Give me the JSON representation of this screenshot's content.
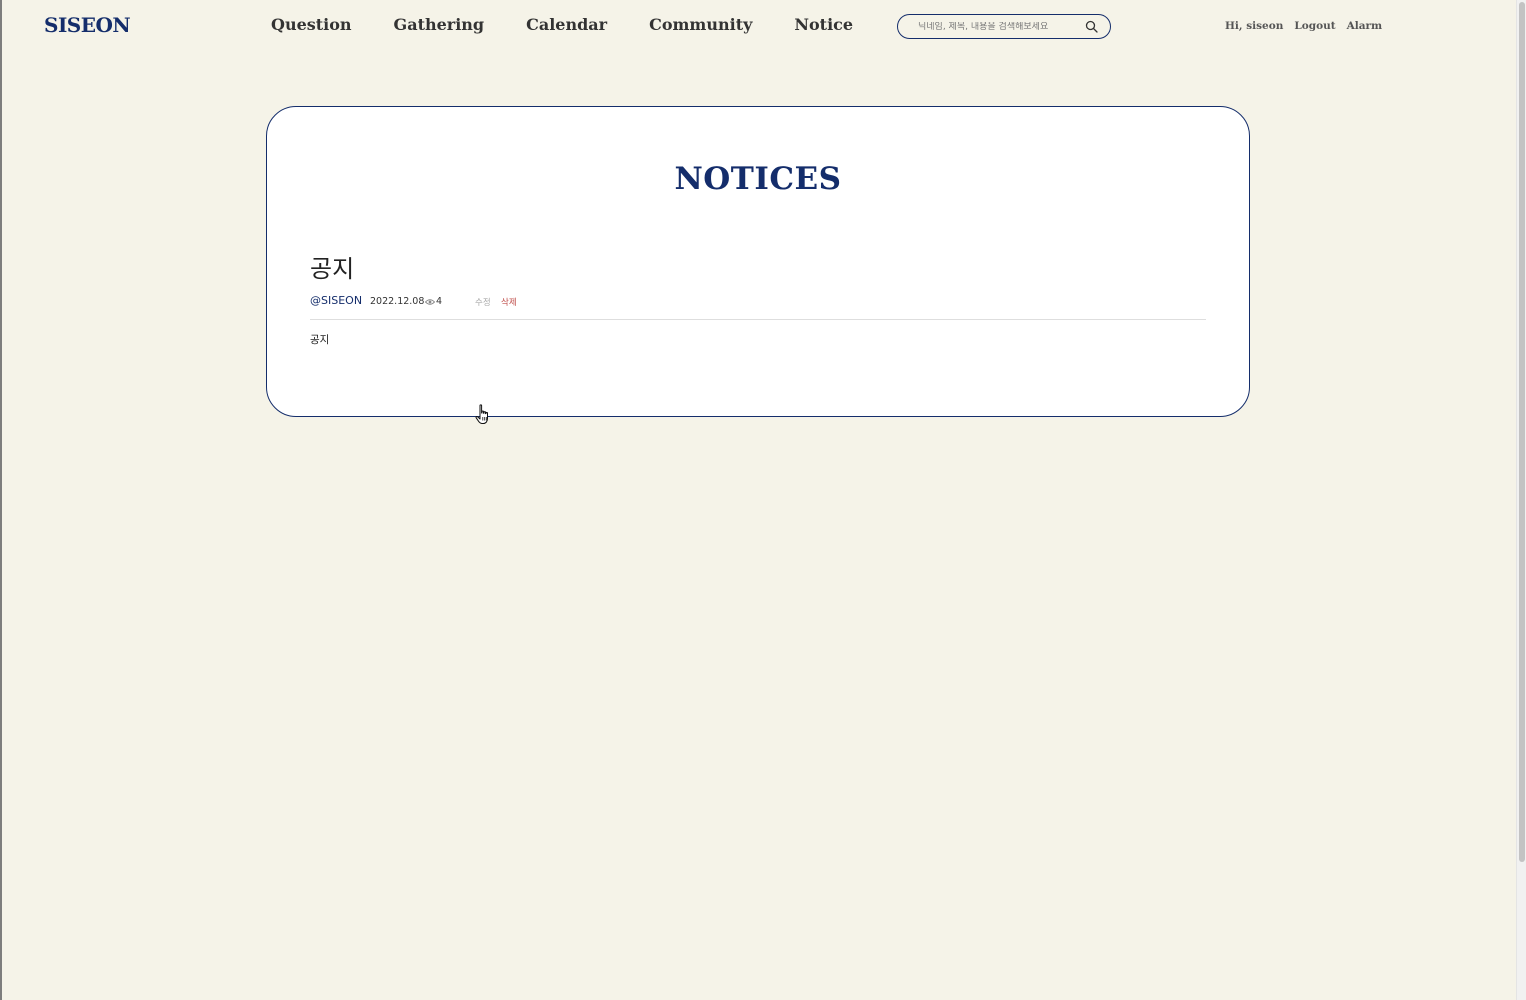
{
  "header": {
    "logo": "SISEON",
    "nav": [
      "Question",
      "Gathering",
      "Calendar",
      "Community",
      "Notice"
    ],
    "search": {
      "placeholder": "닉네임, 제목, 내용을 검색해보세요",
      "icon": "search-icon"
    },
    "user": {
      "greeting": "Hi, siseon",
      "logout": "Logout",
      "alarm": "Alarm"
    }
  },
  "page": {
    "title": "NOTICES",
    "post": {
      "title": "공지",
      "author": "@SISEON",
      "date": "2022.12.08",
      "views": "4",
      "edit_label": "수정",
      "delete_label": "삭제",
      "body": "공지"
    }
  },
  "colors": {
    "background": "#f5f3e8",
    "brand": "#142d6b",
    "delete": "#c0504d",
    "card": "#ffffff"
  }
}
